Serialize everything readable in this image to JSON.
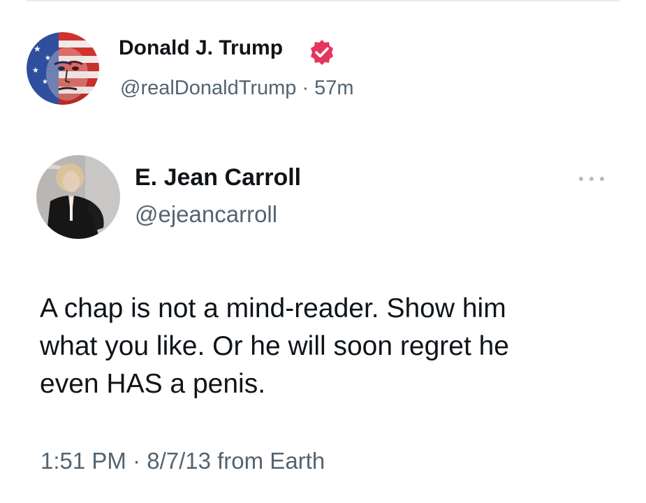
{
  "outer_post": {
    "author_name": "Donald J. Trump",
    "meta": "@realDonaldTrump · 57m",
    "avatar_icon": "flag-portrait-avatar-icon",
    "verified_icon": "verified-badge-icon",
    "verified_color": "#e4365f"
  },
  "quoted_post": {
    "author_name": "E. Jean Carroll",
    "handle": "@ejeancarroll",
    "avatar_icon": "portrait-avatar-icon",
    "more_icon": "more-options-icon",
    "text_lines": [
      "A chap is not a mind-reader. Show him",
      "what you like. Or he will soon regret he",
      "even HAS a penis."
    ],
    "timestamp": "1:51 PM · 8/7/13 from Earth"
  }
}
